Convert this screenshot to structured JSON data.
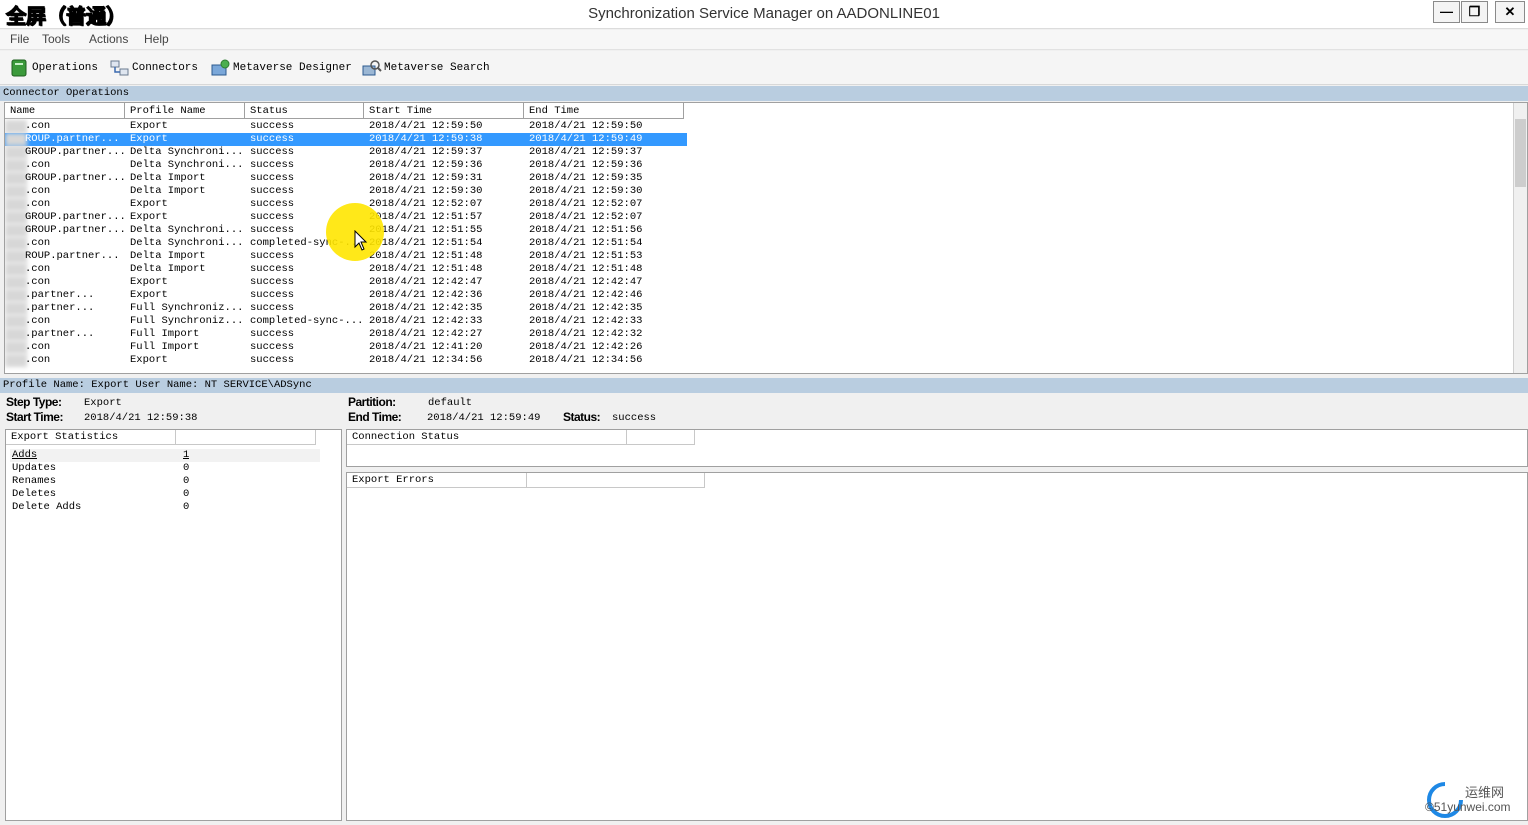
{
  "overlay_label": "全屏（普通）",
  "window": {
    "title": "Synchronization Service Manager on AADONLINE01",
    "minimize": "—",
    "restore": "❐",
    "close": "✕"
  },
  "menu": [
    "File",
    "Tools",
    "Actions",
    "Help"
  ],
  "toolbar": [
    {
      "label": "Operations",
      "icon": "operations-icon"
    },
    {
      "label": "Connectors",
      "icon": "connectors-icon"
    },
    {
      "label": "Metaverse Designer",
      "icon": "metaverse-designer-icon"
    },
    {
      "label": "Metaverse Search",
      "icon": "metaverse-search-icon"
    }
  ],
  "operations_section_title": "Connector Operations",
  "columns": [
    "Name",
    "Profile Name",
    "Status",
    "Start Time",
    "End Time"
  ],
  "rows": [
    {
      "name": ".con",
      "profile": "Export",
      "status": "success",
      "start": "2018/4/21 12:59:50",
      "end": "2018/4/21 12:59:50"
    },
    {
      "name": "ROUP.partner...",
      "profile": "Export",
      "status": "success",
      "start": "2018/4/21 12:59:38",
      "end": "2018/4/21 12:59:49",
      "selected": true
    },
    {
      "name": "GROUP.partner...",
      "profile": "Delta Synchroni...",
      "status": "success",
      "start": "2018/4/21 12:59:37",
      "end": "2018/4/21 12:59:37"
    },
    {
      "name": ".con",
      "profile": "Delta Synchroni...",
      "status": "success",
      "start": "2018/4/21 12:59:36",
      "end": "2018/4/21 12:59:36"
    },
    {
      "name": "GROUP.partner...",
      "profile": "Delta Import",
      "status": "success",
      "start": "2018/4/21 12:59:31",
      "end": "2018/4/21 12:59:35"
    },
    {
      "name": ".con",
      "profile": "Delta Import",
      "status": "success",
      "start": "2018/4/21 12:59:30",
      "end": "2018/4/21 12:59:30"
    },
    {
      "name": ".con",
      "profile": "Export",
      "status": "success",
      "start": "2018/4/21 12:52:07",
      "end": "2018/4/21 12:52:07"
    },
    {
      "name": "GROUP.partner...",
      "profile": "Export",
      "status": "success",
      "start": "2018/4/21 12:51:57",
      "end": "2018/4/21 12:52:07"
    },
    {
      "name": "GROUP.partner...",
      "profile": "Delta Synchroni...",
      "status": "success",
      "start": "2018/4/21 12:51:55",
      "end": "2018/4/21 12:51:56"
    },
    {
      "name": ".con",
      "profile": "Delta Synchroni...",
      "status": "completed-sync-...",
      "start": "2018/4/21 12:51:54",
      "end": "2018/4/21 12:51:54"
    },
    {
      "name": "ROUP.partner...",
      "profile": "Delta Import",
      "status": "success",
      "start": "2018/4/21 12:51:48",
      "end": "2018/4/21 12:51:53"
    },
    {
      "name": ".con",
      "profile": "Delta Import",
      "status": "success",
      "start": "2018/4/21 12:51:48",
      "end": "2018/4/21 12:51:48"
    },
    {
      "name": ".con",
      "profile": "Export",
      "status": "success",
      "start": "2018/4/21 12:42:47",
      "end": "2018/4/21 12:42:47"
    },
    {
      "name": ".partner...",
      "profile": "Export",
      "status": "success",
      "start": "2018/4/21 12:42:36",
      "end": "2018/4/21 12:42:46"
    },
    {
      "name": ".partner...",
      "profile": "Full Synchroniz...",
      "status": "success",
      "start": "2018/4/21 12:42:35",
      "end": "2018/4/21 12:42:35"
    },
    {
      "name": ".con",
      "profile": "Full Synchroniz...",
      "status": "completed-sync-...",
      "start": "2018/4/21 12:42:33",
      "end": "2018/4/21 12:42:33"
    },
    {
      "name": ".partner...",
      "profile": "Full Import",
      "status": "success",
      "start": "2018/4/21 12:42:27",
      "end": "2018/4/21 12:42:32"
    },
    {
      "name": ".con",
      "profile": "Full Import",
      "status": "success",
      "start": "2018/4/21 12:41:20",
      "end": "2018/4/21 12:42:26"
    },
    {
      "name": ".con",
      "profile": "Export",
      "status": "success",
      "start": "2018/4/21 12:34:56",
      "end": "2018/4/21 12:34:56"
    }
  ],
  "profile_bar": "Profile Name: Export  User Name: NT SERVICE\\ADSync",
  "details": {
    "step_type_label": "Step Type:",
    "step_type": "Export",
    "start_time_label": "Start Time:",
    "start_time": "2018/4/21 12:59:38",
    "partition_label": "Partition:",
    "partition": "default",
    "end_time_label": "End Time:",
    "end_time": "2018/4/21 12:59:49",
    "status_label": "Status:",
    "status": "success"
  },
  "export_statistics": {
    "header": "Export Statistics",
    "rows": [
      {
        "label": "Adds",
        "value": "1"
      },
      {
        "label": "Updates",
        "value": "0"
      },
      {
        "label": "Renames",
        "value": "0"
      },
      {
        "label": "Deletes",
        "value": "0"
      },
      {
        "label": "Delete Adds",
        "value": "0"
      }
    ]
  },
  "connection_status_header": "Connection Status",
  "export_errors_header": "Export Errors",
  "watermark": {
    "line1": "运维网",
    "line2": "©51yunwei.com"
  }
}
